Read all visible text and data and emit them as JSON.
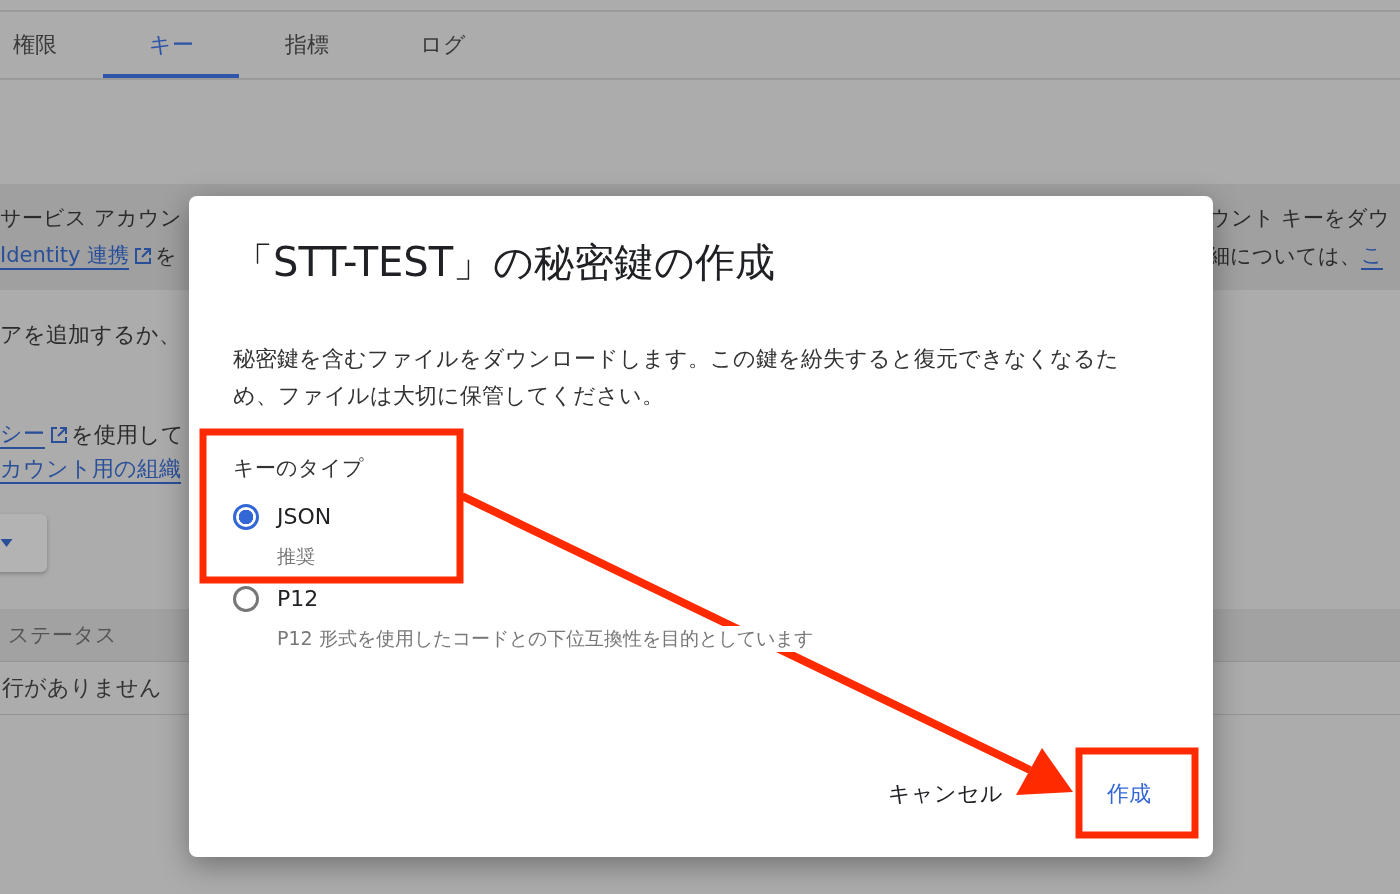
{
  "tabs": [
    {
      "label": "権限",
      "selected": false
    },
    {
      "label": "キー",
      "selected": true
    },
    {
      "label": "指標",
      "selected": false
    },
    {
      "label": "ログ",
      "selected": false
    }
  ],
  "background": {
    "banner": {
      "left_lines": [
        [
          {
            "text": "サービス アカウン"
          }
        ],
        [
          {
            "text": "Identity 連携",
            "link": true,
            "external": true
          },
          {
            "text": "を"
          }
        ]
      ],
      "right_lines": [
        [
          {
            "text": "ウント キーをダウ"
          }
        ],
        [
          {
            "text": "細については、"
          },
          {
            "text": "こ",
            "link": true
          }
        ]
      ]
    },
    "paragraphs": [
      [
        [
          {
            "text": "アを追加するか、"
          }
        ]
      ],
      [
        [
          {
            "text": "シー",
            "link": true,
            "external": true
          },
          {
            "text": "を使用して"
          }
        ],
        [
          {
            "text": "カウント用の組織",
            "link": true
          }
        ]
      ]
    ],
    "dropdown": {
      "expanded": false
    },
    "table": {
      "columns": [
        "ステータス"
      ],
      "empty_message": "行がありません"
    }
  },
  "dialog": {
    "title": "「STT-TEST」の秘密鍵の作成",
    "description": "秘密鍵を含むファイルをダウンロードします。この鍵を紛失すると復元できなくなるため、ファイルは大切に保管してください。",
    "group_label": "キーのタイプ",
    "options": [
      {
        "label": "JSON",
        "hint": "推奨",
        "selected": true
      },
      {
        "label": "P12",
        "hint": "P12 形式を使用したコードとの下位互換性を目的としています",
        "selected": false
      }
    ],
    "buttons": [
      {
        "label": "キャンセル",
        "kind": "text"
      },
      {
        "label": "作成",
        "kind": "primary"
      }
    ]
  }
}
